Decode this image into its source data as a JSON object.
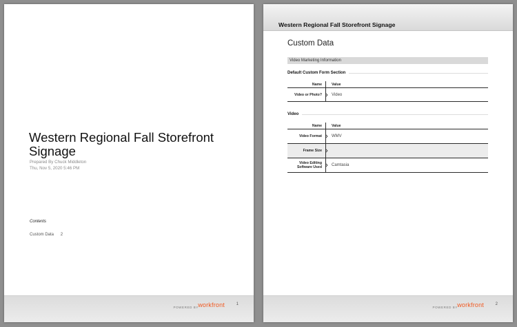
{
  "doc": {
    "title": "Western Regional Fall Storefront Signage",
    "prepared_by": "Prepared By Chuck Middleton",
    "date": "Thu, Nov 5, 2020 5:46 PM"
  },
  "contents": {
    "heading": "Contents",
    "items": [
      {
        "label": "Custom Data",
        "page": "2"
      }
    ]
  },
  "footer": {
    "powered": "POWERED BY",
    "brand": "workfront",
    "page1": "1",
    "page2": "2"
  },
  "page2": {
    "header_title": "Western Regional Fall Storefront Signage",
    "section_title": "Custom Data",
    "form_bar": "Video Marketing Information",
    "col_name": "Name",
    "col_value": "Value",
    "sections": [
      {
        "title": "Default Custom Form Section",
        "rows": [
          {
            "name": "Video or Photo?",
            "value": "Video"
          }
        ]
      },
      {
        "title": "Video",
        "rows": [
          {
            "name": "Video Format",
            "value": "WMV"
          },
          {
            "name": "Frame Size",
            "value": ""
          },
          {
            "name": "Video Editing Software Used",
            "value": "Camtasia"
          }
        ]
      }
    ]
  },
  "colors": {
    "background": "#8f8f8f",
    "brand_orange": "#f15a22",
    "bar_gray": "#d9d9d9"
  }
}
